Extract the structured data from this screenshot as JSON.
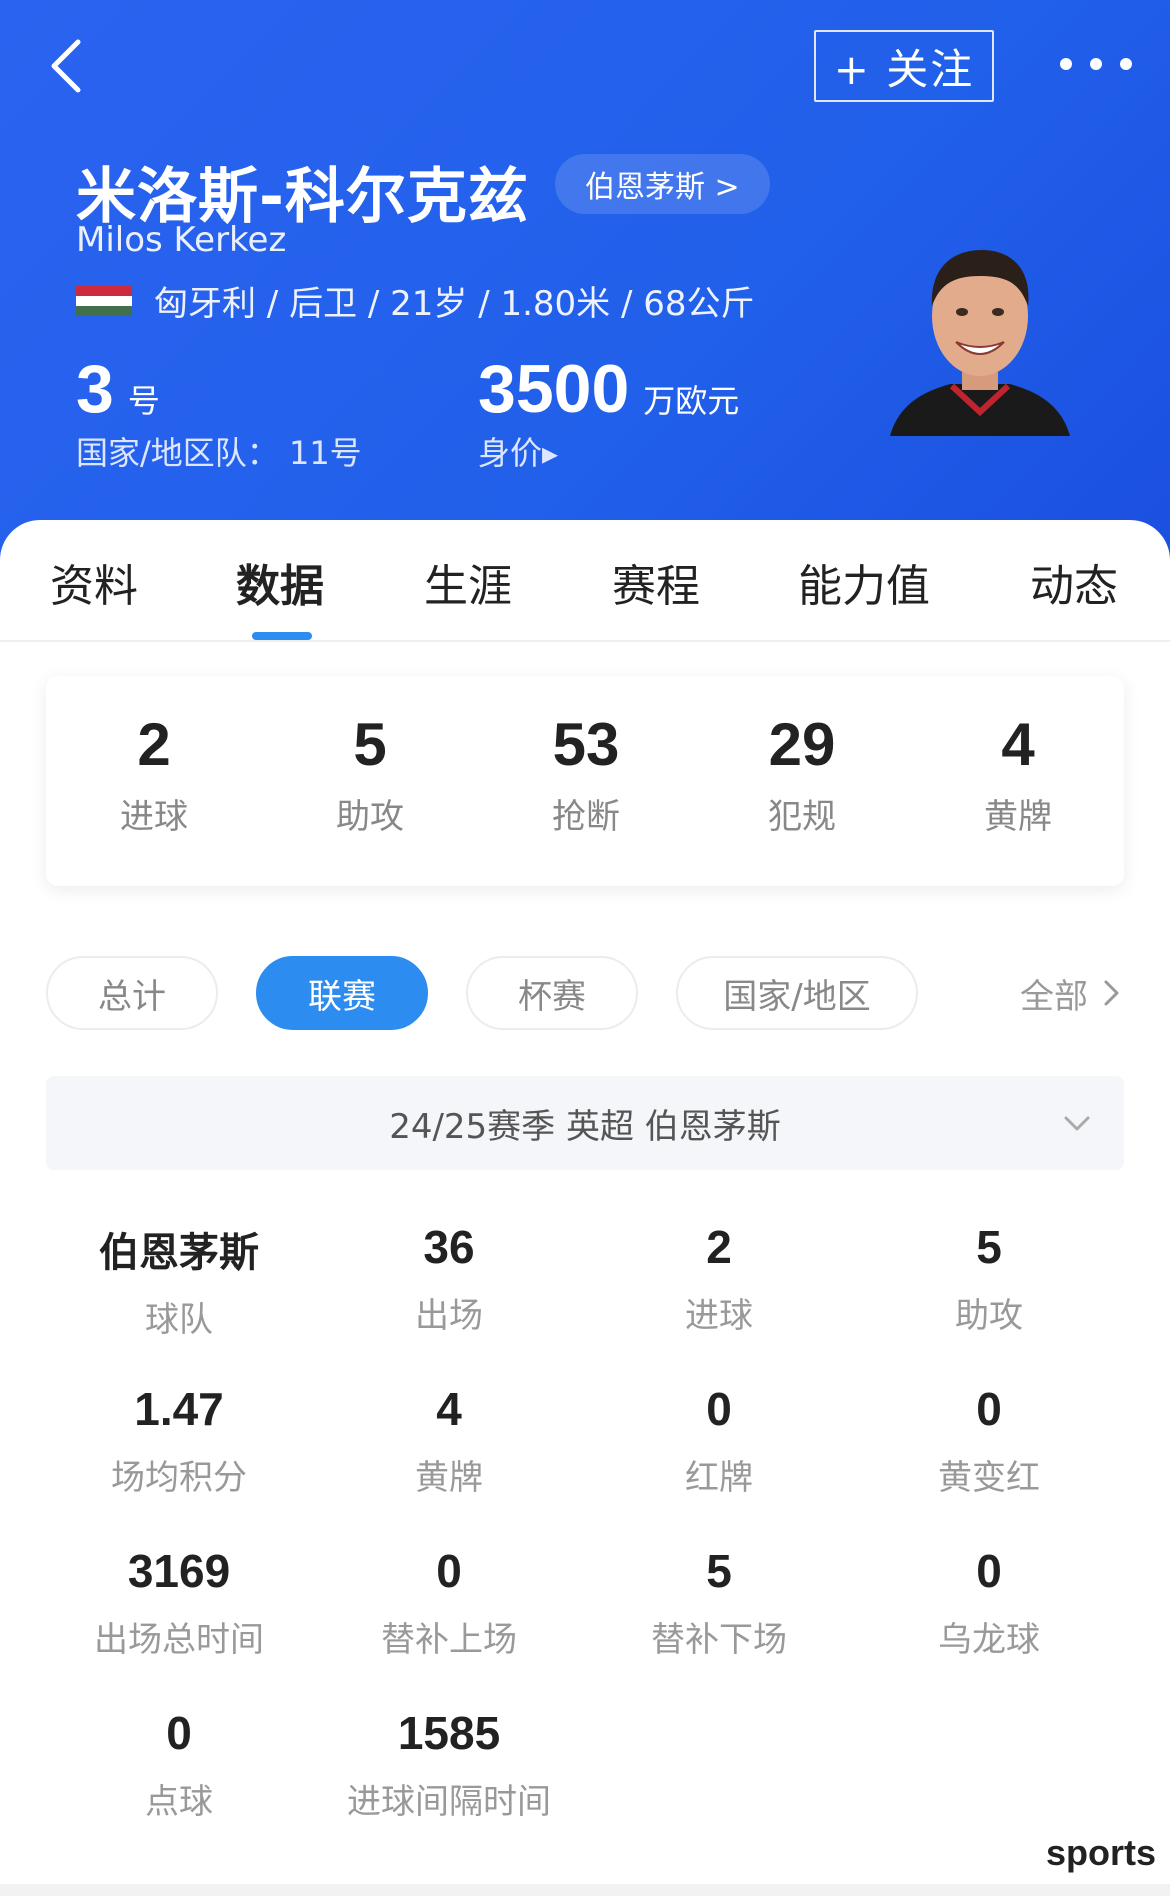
{
  "header": {
    "follow_label": "+ 关注",
    "name_cn": "米洛斯-科尔克兹",
    "club_chip": "伯恩茅斯 >",
    "name_en": "Milos Kerkez",
    "info": "匈牙利 / 后卫 / 21岁 / 1.80米 / 68公斤",
    "shirt_number": "3",
    "shirt_unit": "号",
    "national_team": "国家/地区队：  11号",
    "market_value": "3500",
    "market_value_unit": "万欧元",
    "market_value_label": "身价▸",
    "flag_colors": [
      "#cd2a3e",
      "#ffffff",
      "#436f4d"
    ]
  },
  "tabs": [
    {
      "label": "资料"
    },
    {
      "label": "数据",
      "active": true
    },
    {
      "label": "生涯"
    },
    {
      "label": "赛程"
    },
    {
      "label": "能力值"
    },
    {
      "label": "动态"
    }
  ],
  "summary": [
    {
      "value": "2",
      "label": "进球"
    },
    {
      "value": "5",
      "label": "助攻"
    },
    {
      "value": "53",
      "label": "抢断"
    },
    {
      "value": "29",
      "label": "犯规"
    },
    {
      "value": "4",
      "label": "黄牌"
    }
  ],
  "filters": [
    {
      "label": "总计"
    },
    {
      "label": "联赛",
      "active": true
    },
    {
      "label": "杯赛"
    },
    {
      "label": "国家/地区"
    }
  ],
  "all_link": "全部",
  "season": "24/25赛季  英超  伯恩茅斯",
  "stats": [
    {
      "value": "伯恩茅斯",
      "label": "球队"
    },
    {
      "value": "36",
      "label": "出场"
    },
    {
      "value": "2",
      "label": "进球"
    },
    {
      "value": "5",
      "label": "助攻"
    },
    {
      "value": "1.47",
      "label": "场均积分"
    },
    {
      "value": "4",
      "label": "黄牌"
    },
    {
      "value": "0",
      "label": "红牌"
    },
    {
      "value": "0",
      "label": "黄变红"
    },
    {
      "value": "3169",
      "label": "出场总时间"
    },
    {
      "value": "0",
      "label": "替补上场"
    },
    {
      "value": "5",
      "label": "替补下场"
    },
    {
      "value": "0",
      "label": "乌龙球"
    },
    {
      "value": "0",
      "label": "点球"
    },
    {
      "value": "1585",
      "label": "进球间隔时间"
    }
  ],
  "watermark": "sports",
  "colors": {
    "header_blue": "#2160ea",
    "accent": "#2d8cf0"
  }
}
